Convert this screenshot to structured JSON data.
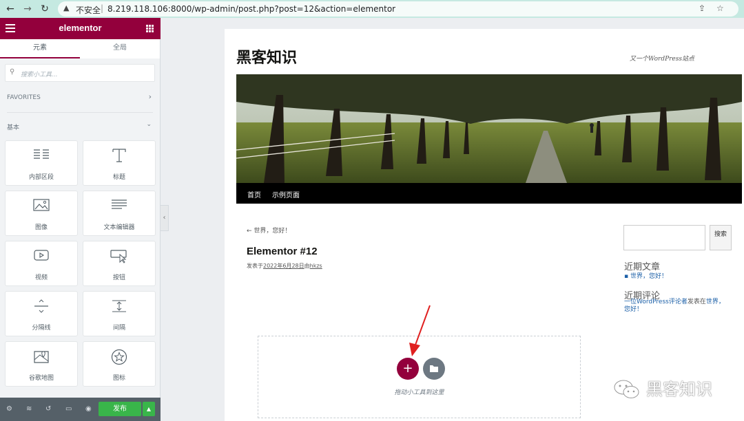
{
  "browser": {
    "warning": "不安全",
    "url": "8.219.118.106:8000/wp-admin/post.php?post=12&action=elementor"
  },
  "panel": {
    "logo": "elementor",
    "tabs": [
      "元素",
      "全局"
    ],
    "search_placeholder": "搜索小工具...",
    "favorites_label": "FAVORITES",
    "basic_label": "基本",
    "widgets": [
      {
        "label": "内部区段",
        "icon": "inner-section-icon"
      },
      {
        "label": "标题",
        "icon": "heading-icon"
      },
      {
        "label": "图像",
        "icon": "image-icon"
      },
      {
        "label": "文本编辑器",
        "icon": "text-editor-icon"
      },
      {
        "label": "视频",
        "icon": "video-icon"
      },
      {
        "label": "按钮",
        "icon": "button-icon"
      },
      {
        "label": "分隔线",
        "icon": "divider-icon"
      },
      {
        "label": "间隔",
        "icon": "spacer-icon"
      },
      {
        "label": "谷歌地图",
        "icon": "google-maps-icon"
      },
      {
        "label": "图标",
        "icon": "star-icon"
      }
    ],
    "publish_label": "发布",
    "accent_color": "#93003c",
    "publish_color": "#39b54a"
  },
  "preview": {
    "site_title": "黑客知识",
    "tagline": "又一个WordPress站点",
    "nav": [
      "首页",
      "示例页面"
    ],
    "prev_link": "← 世界，您好！",
    "post_title": "Elementor #12",
    "post_meta": {
      "prefix": "发表于",
      "date": "2022年6月28日",
      "by": "由",
      "author": "hkzs"
    },
    "sidebar": {
      "search_button": "搜索",
      "recent_posts_title": "近期文章",
      "recent_posts": [
        "世界，您好！"
      ],
      "recent_comments_title": "近期评论",
      "recent_comment": {
        "author": "一位WordPress评论者",
        "text": "发表在",
        "post_line1": "世界，",
        "post_line2": "您好！"
      }
    },
    "drop_text": "拖动小工具到这里"
  },
  "watermark": "黑客知识"
}
